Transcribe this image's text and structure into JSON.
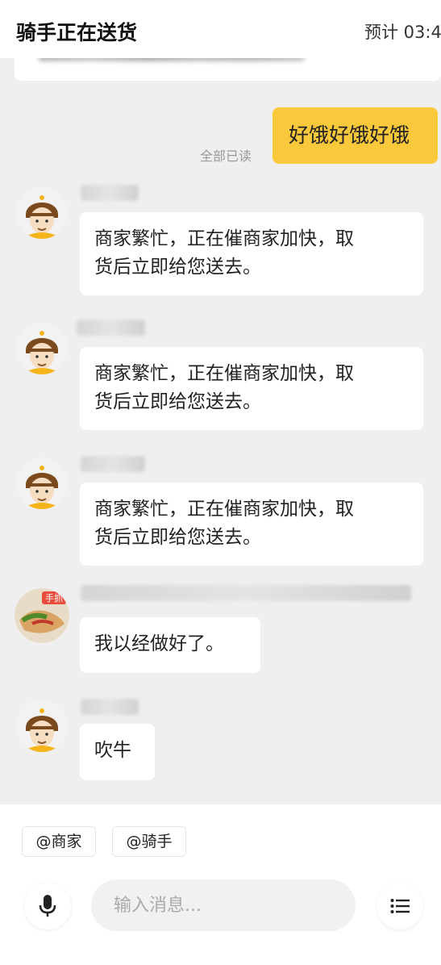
{
  "header": {
    "title": "骑手正在送货",
    "eta": "预计 03:4"
  },
  "messages": {
    "mine": {
      "text": "好饿好饿好饿",
      "status": "全部已读"
    },
    "rider_1": {
      "line1": "商家繁忙，正在催商家加快，取",
      "line2": "货后立即给您送去。"
    },
    "rider_2": {
      "line1": "商家繁忙，正在催商家加快，取",
      "line2": "货后立即给您送去。"
    },
    "rider_3": {
      "line1": "商家繁忙，正在催商家加快，取",
      "line2": "货后立即给您送去。"
    },
    "merchant": {
      "text": "我以经做好了。",
      "avatar_label": "手抓"
    },
    "rider_4": {
      "text": "吹牛"
    }
  },
  "quick_mentions": {
    "merchant": "@商家",
    "rider": "@骑手"
  },
  "composer": {
    "placeholder": "输入消息..."
  },
  "icons": {
    "voice": "microphone-icon",
    "more": "list-menu-icon"
  },
  "colors": {
    "my_bubble": "#f9c93b",
    "background": "#efefef",
    "rider_helmet": "#7a4a1c",
    "rider_badge": "#f4b41a"
  }
}
